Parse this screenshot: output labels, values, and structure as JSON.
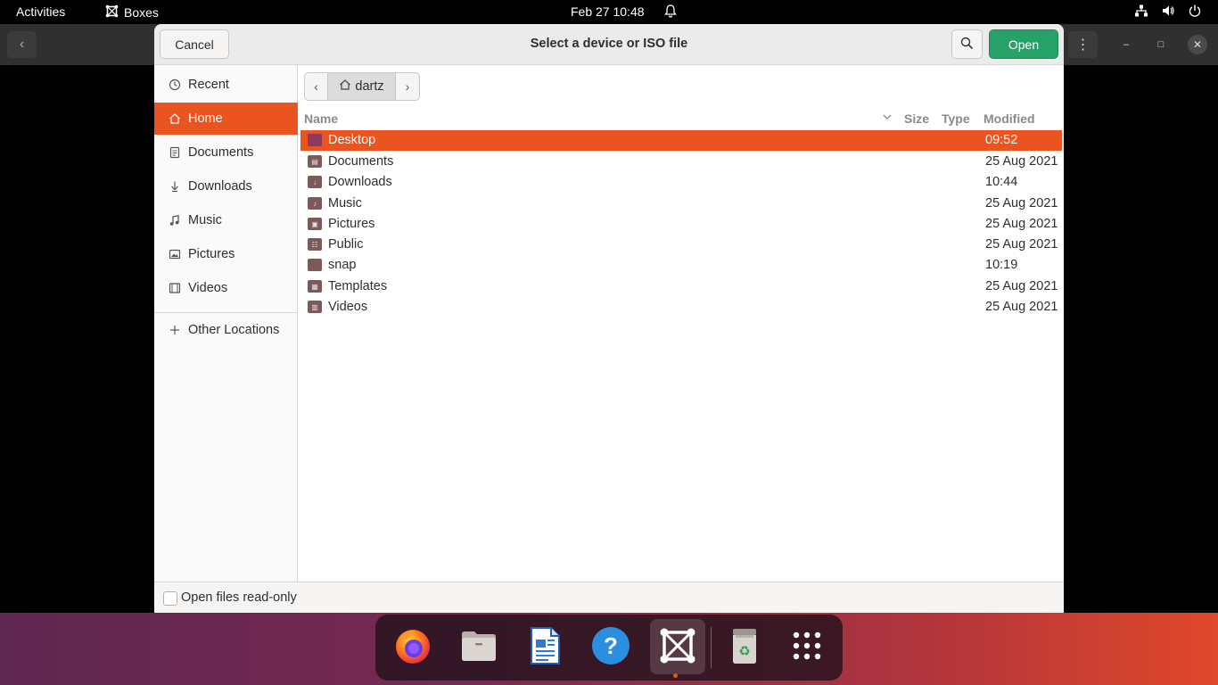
{
  "topbar": {
    "activities": "Activities",
    "app_name": "Boxes",
    "clock": "Feb 27  10:48"
  },
  "dialog": {
    "title": "Select a device or ISO file",
    "cancel_label": "Cancel",
    "open_label": "Open",
    "read_only_label": "Open files read-only"
  },
  "sidebar": {
    "items": [
      {
        "label": "Recent",
        "icon": "clock-icon"
      },
      {
        "label": "Home",
        "icon": "home-icon"
      },
      {
        "label": "Documents",
        "icon": "document-icon"
      },
      {
        "label": "Downloads",
        "icon": "download-icon"
      },
      {
        "label": "Music",
        "icon": "music-icon"
      },
      {
        "label": "Pictures",
        "icon": "picture-icon"
      },
      {
        "label": "Videos",
        "icon": "video-icon"
      }
    ],
    "other_locations": "Other Locations",
    "active_item": "Home"
  },
  "pathbar": {
    "crumb": "dartz"
  },
  "columns": {
    "name": "Name",
    "size": "Size",
    "type": "Type",
    "modified": "Modified"
  },
  "files": [
    {
      "name": "Desktop",
      "modified": "09:52",
      "selected": true
    },
    {
      "name": "Documents",
      "modified": "25 Aug 2021"
    },
    {
      "name": "Downloads",
      "modified": "10:44"
    },
    {
      "name": "Music",
      "modified": "25 Aug 2021"
    },
    {
      "name": "Pictures",
      "modified": "25 Aug 2021"
    },
    {
      "name": "Public",
      "modified": "25 Aug 2021"
    },
    {
      "name": "snap",
      "modified": "10:19"
    },
    {
      "name": "Templates",
      "modified": "25 Aug 2021"
    },
    {
      "name": "Videos",
      "modified": "25 Aug 2021"
    }
  ],
  "dock": {
    "apps": [
      "firefox-icon",
      "files-icon",
      "writer-icon",
      "help-icon",
      "boxes-icon",
      "trash-icon",
      "app-grid-icon"
    ],
    "running_app": "boxes-icon"
  },
  "colors": {
    "accent": "#e95420",
    "open_button": "#26a269"
  }
}
